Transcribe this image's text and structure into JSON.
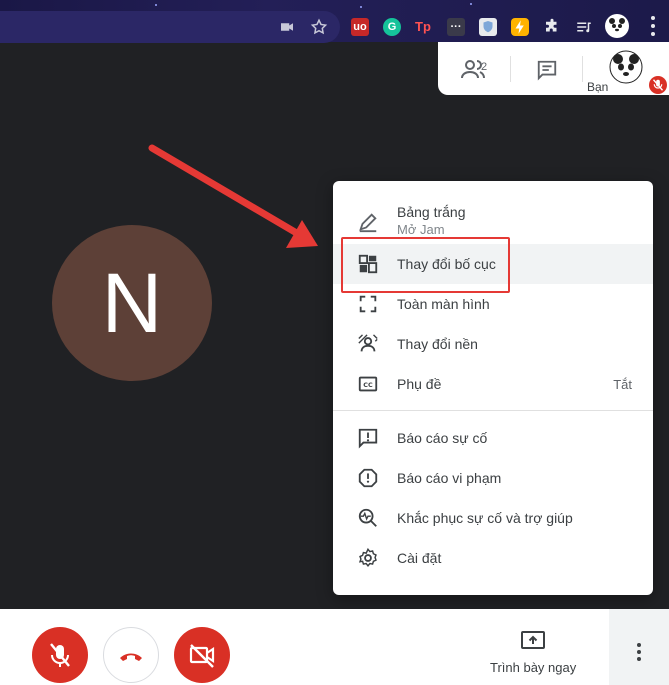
{
  "top_panel": {
    "participants_count": "2",
    "you_label": "Bạn"
  },
  "participant": {
    "initial": "N",
    "avatar_color": "#5d4037"
  },
  "menu": {
    "items": [
      {
        "label": "Bảng trắng",
        "sub": "Mở Jam",
        "icon": "pencil-icon"
      },
      {
        "label": "Thay đổi bố cục",
        "icon": "layout-icon"
      },
      {
        "label": "Toàn màn hình",
        "icon": "fullscreen-icon"
      },
      {
        "label": "Thay đổi nền",
        "icon": "background-icon"
      },
      {
        "label": "Phụ đề",
        "right": "Tắt",
        "icon": "captions-icon"
      },
      {
        "label": "Báo cáo sự cố",
        "icon": "report-problem-icon"
      },
      {
        "label": "Báo cáo vi phạm",
        "icon": "report-abuse-icon"
      },
      {
        "label": "Khắc phục sự cố và trợ giúp",
        "icon": "troubleshoot-icon"
      },
      {
        "label": "Cài đặt",
        "icon": "settings-icon"
      }
    ]
  },
  "bottom_bar": {
    "present_label": "Trình bày ngay"
  },
  "colors": {
    "meet_red": "#d93025",
    "annotation_red": "#e53935",
    "background": "#202124"
  }
}
